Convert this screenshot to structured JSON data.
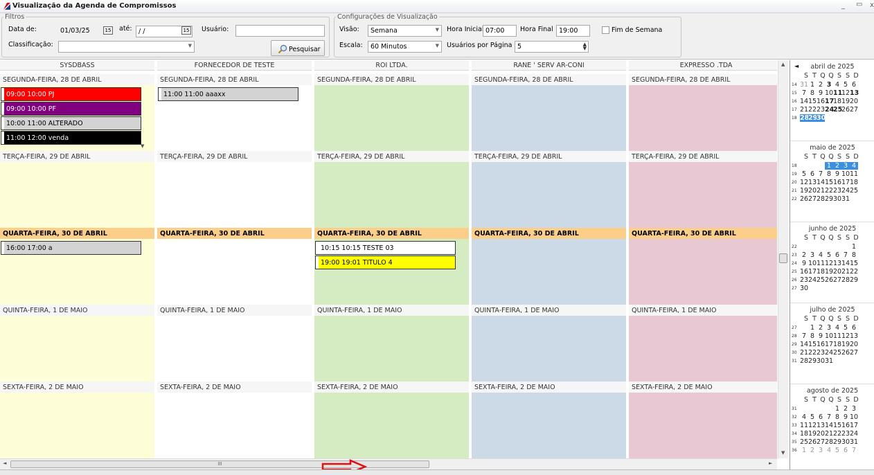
{
  "window": {
    "title": "Visualização da Agenda de Compromissos",
    "minimize": "_",
    "maximize": "▭",
    "close": "x"
  },
  "filtros": {
    "legend": "Filtros",
    "data_de_label": "Data de:",
    "data_de_value": "01/03/25",
    "ate_label": "até:",
    "ate_value": " / /",
    "usuario_label": "Usuário:",
    "usuario_value": "",
    "classificacao_label": "Classificação:",
    "classificacao_value": "",
    "pesquisar_label": "Pesquisar"
  },
  "config": {
    "legend": "Configurações de Visualização",
    "visao_label": "Visão:",
    "visao_value": "Semana",
    "hora_inicial_label": "Hora Inicial",
    "hora_inicial_value": "07:00",
    "hora_final_label": "Hora Final",
    "hora_final_value": "19:00",
    "fim_semana_label": "Fim de Semana",
    "escala_label": "Escala:",
    "escala_value": "60 Minutos",
    "usuarios_pagina_label": "Usuários por Página",
    "usuarios_pagina_value": "5"
  },
  "columns": [
    {
      "header": "SYSDBASS",
      "bg": "#fdfdd8"
    },
    {
      "header": "FORNECEDOR DE TESTE",
      "bg": "#ffffff"
    },
    {
      "header": "ROI                          LTDA.",
      "bg": "#d5ecc2"
    },
    {
      "header": "RANE '                        SERV AR-CONI",
      "bg": "#ccdae7"
    },
    {
      "header": "EXPRESSO              .TDA",
      "bg": "#e7c8d3"
    }
  ],
  "days": [
    {
      "label": "SEGUNDA-FEIRA, 28 DE ABRIL",
      "today": false
    },
    {
      "label": "TERÇA-FEIRA, 29 DE ABRIL",
      "today": false
    },
    {
      "label": "QUARTA-FEIRA, 30 DE ABRIL",
      "today": true
    },
    {
      "label": "QUINTA-FEIRA, 1 DE MAIO",
      "today": false
    },
    {
      "label": "SEXTA-FEIRA, 2 DE MAIO",
      "today": false
    }
  ],
  "events": {
    "c0d0": [
      {
        "text": "09:00 10:00 PJ",
        "bg": "#ff0000",
        "fg": "#ffffff"
      },
      {
        "text": "09:00 10:00 PF",
        "bg": "#800080",
        "fg": "#ffffff"
      },
      {
        "text": "10:00 11:00 ALTERADO",
        "bg": "#d3d3d3",
        "fg": "#000000"
      },
      {
        "text": "11:00 12:00 venda",
        "bg": "#000000",
        "fg": "#ffffff"
      }
    ],
    "c1d0": [
      {
        "text": "11:00 11:00 aaaxx",
        "bg": "#d3d3d3",
        "fg": "#000000"
      }
    ],
    "c0d2": [
      {
        "text": "16:00 17:00 a",
        "bg": "#d3d3d3",
        "fg": "#000000"
      }
    ],
    "c2d2": [
      {
        "text": "10:15 10:15 TESTE 03",
        "bg": "#ffffff",
        "fg": "#000000"
      },
      {
        "text": "19:00 19:01 TITULO 4",
        "bg": "#ffff00",
        "fg": "#000000"
      }
    ]
  },
  "calendar": {
    "dow": [
      "S",
      "T",
      "Q",
      "Q",
      "S",
      "S",
      "D"
    ],
    "months": [
      {
        "title": "abril de 2025",
        "weeks": [
          {
            "n": "14",
            "days": [
              {
                "d": "31",
                "s": "gray"
              },
              {
                "d": "1"
              },
              {
                "d": "2"
              },
              {
                "d": "3",
                "s": "b"
              },
              {
                "d": "4"
              },
              {
                "d": "5"
              },
              {
                "d": "6"
              }
            ]
          },
          {
            "n": "15",
            "days": [
              {
                "d": "7"
              },
              {
                "d": "8"
              },
              {
                "d": "9"
              },
              {
                "d": "10"
              },
              {
                "d": "11",
                "s": "b"
              },
              {
                "d": "12"
              },
              {
                "d": "13",
                "s": "b"
              }
            ]
          },
          {
            "n": "16",
            "days": [
              {
                "d": "14"
              },
              {
                "d": "15"
              },
              {
                "d": "16"
              },
              {
                "d": "17",
                "s": "b"
              },
              {
                "d": "18"
              },
              {
                "d": "19"
              },
              {
                "d": "20"
              }
            ]
          },
          {
            "n": "17",
            "days": [
              {
                "d": "21"
              },
              {
                "d": "22"
              },
              {
                "d": "23"
              },
              {
                "d": "24",
                "s": "b"
              },
              {
                "d": "25",
                "s": "b"
              },
              {
                "d": "26"
              },
              {
                "d": "27"
              }
            ]
          },
          {
            "n": "18",
            "days": [
              {
                "d": "28",
                "s": "selb"
              },
              {
                "d": "29",
                "s": "selb"
              },
              {
                "d": "30",
                "s": "selb"
              }
            ]
          }
        ]
      },
      {
        "title": "maio de 2025",
        "weeks": [
          {
            "n": "18",
            "days": [
              {
                "d": ""
              },
              {
                "d": ""
              },
              {
                "d": ""
              },
              {
                "d": "1",
                "s": "sel"
              },
              {
                "d": "2",
                "s": "sel"
              },
              {
                "d": "3",
                "s": "sel"
              },
              {
                "d": "4",
                "s": "sel"
              }
            ]
          },
          {
            "n": "19",
            "days": [
              {
                "d": "5"
              },
              {
                "d": "6"
              },
              {
                "d": "7"
              },
              {
                "d": "8"
              },
              {
                "d": "9"
              },
              {
                "d": "10"
              },
              {
                "d": "11"
              }
            ]
          },
          {
            "n": "20",
            "days": [
              {
                "d": "12"
              },
              {
                "d": "13"
              },
              {
                "d": "14"
              },
              {
                "d": "15"
              },
              {
                "d": "16"
              },
              {
                "d": "17"
              },
              {
                "d": "18"
              }
            ]
          },
          {
            "n": "21",
            "days": [
              {
                "d": "19"
              },
              {
                "d": "20"
              },
              {
                "d": "21"
              },
              {
                "d": "22"
              },
              {
                "d": "23"
              },
              {
                "d": "24"
              },
              {
                "d": "25"
              }
            ]
          },
          {
            "n": "22",
            "days": [
              {
                "d": "26"
              },
              {
                "d": "27"
              },
              {
                "d": "28"
              },
              {
                "d": "29"
              },
              {
                "d": "30"
              },
              {
                "d": "31"
              }
            ]
          }
        ]
      },
      {
        "title": "junho de 2025",
        "weeks": [
          {
            "n": "22",
            "days": [
              {
                "d": ""
              },
              {
                "d": ""
              },
              {
                "d": ""
              },
              {
                "d": ""
              },
              {
                "d": ""
              },
              {
                "d": ""
              },
              {
                "d": "1"
              }
            ]
          },
          {
            "n": "23",
            "days": [
              {
                "d": "2"
              },
              {
                "d": "3"
              },
              {
                "d": "4"
              },
              {
                "d": "5"
              },
              {
                "d": "6"
              },
              {
                "d": "7"
              },
              {
                "d": "8"
              }
            ]
          },
          {
            "n": "24",
            "days": [
              {
                "d": "9"
              },
              {
                "d": "10"
              },
              {
                "d": "11"
              },
              {
                "d": "12"
              },
              {
                "d": "13"
              },
              {
                "d": "14"
              },
              {
                "d": "15"
              }
            ]
          },
          {
            "n": "25",
            "days": [
              {
                "d": "16"
              },
              {
                "d": "17"
              },
              {
                "d": "18"
              },
              {
                "d": "19"
              },
              {
                "d": "20"
              },
              {
                "d": "21"
              },
              {
                "d": "22"
              }
            ]
          },
          {
            "n": "26",
            "days": [
              {
                "d": "23"
              },
              {
                "d": "24"
              },
              {
                "d": "25"
              },
              {
                "d": "26"
              },
              {
                "d": "27"
              },
              {
                "d": "28"
              },
              {
                "d": "29"
              }
            ]
          },
          {
            "n": "27",
            "days": [
              {
                "d": "30"
              }
            ]
          }
        ]
      },
      {
        "title": "julho de 2025",
        "weeks": [
          {
            "n": "27",
            "days": [
              {
                "d": ""
              },
              {
                "d": "1"
              },
              {
                "d": "2"
              },
              {
                "d": "3"
              },
              {
                "d": "4"
              },
              {
                "d": "5"
              },
              {
                "d": "6"
              }
            ]
          },
          {
            "n": "28",
            "days": [
              {
                "d": "7"
              },
              {
                "d": "8"
              },
              {
                "d": "9"
              },
              {
                "d": "10"
              },
              {
                "d": "11"
              },
              {
                "d": "12"
              },
              {
                "d": "13"
              }
            ]
          },
          {
            "n": "29",
            "days": [
              {
                "d": "14"
              },
              {
                "d": "15"
              },
              {
                "d": "16"
              },
              {
                "d": "17"
              },
              {
                "d": "18"
              },
              {
                "d": "19"
              },
              {
                "d": "20"
              }
            ]
          },
          {
            "n": "30",
            "days": [
              {
                "d": "21"
              },
              {
                "d": "22"
              },
              {
                "d": "23"
              },
              {
                "d": "24"
              },
              {
                "d": "25"
              },
              {
                "d": "26"
              },
              {
                "d": "27"
              }
            ]
          },
          {
            "n": "31",
            "days": [
              {
                "d": "28"
              },
              {
                "d": "29"
              },
              {
                "d": "30"
              },
              {
                "d": "31"
              }
            ]
          }
        ]
      },
      {
        "title": "agosto de 2025",
        "weeks": [
          {
            "n": "31",
            "days": [
              {
                "d": ""
              },
              {
                "d": ""
              },
              {
                "d": ""
              },
              {
                "d": ""
              },
              {
                "d": "1"
              },
              {
                "d": "2"
              },
              {
                "d": "3"
              }
            ]
          },
          {
            "n": "32",
            "days": [
              {
                "d": "4"
              },
              {
                "d": "5"
              },
              {
                "d": "6"
              },
              {
                "d": "7"
              },
              {
                "d": "8"
              },
              {
                "d": "9"
              },
              {
                "d": "10"
              }
            ]
          },
          {
            "n": "33",
            "days": [
              {
                "d": "11"
              },
              {
                "d": "12"
              },
              {
                "d": "13"
              },
              {
                "d": "14"
              },
              {
                "d": "15"
              },
              {
                "d": "16"
              },
              {
                "d": "17"
              }
            ]
          },
          {
            "n": "34",
            "days": [
              {
                "d": "18"
              },
              {
                "d": "19"
              },
              {
                "d": "20"
              },
              {
                "d": "21"
              },
              {
                "d": "22"
              },
              {
                "d": "23"
              },
              {
                "d": "24"
              }
            ]
          },
          {
            "n": "35",
            "days": [
              {
                "d": "25"
              },
              {
                "d": "26"
              },
              {
                "d": "27"
              },
              {
                "d": "28"
              },
              {
                "d": "29"
              },
              {
                "d": "30"
              },
              {
                "d": "31"
              }
            ]
          },
          {
            "n": "36",
            "days": [
              {
                "d": "1",
                "s": "gray"
              },
              {
                "d": "2",
                "s": "gray"
              },
              {
                "d": "3",
                "s": "gray"
              },
              {
                "d": "4",
                "s": "gray"
              },
              {
                "d": "5",
                "s": "gray"
              },
              {
                "d": "6",
                "s": "gray"
              },
              {
                "d": "7",
                "s": "gray"
              }
            ]
          }
        ]
      }
    ]
  },
  "scroll": {
    "h_thumb_grip": "III"
  },
  "icons": {
    "calendar": "calendar-icon",
    "search": "magnifier-icon",
    "app": "app-logo-icon"
  }
}
